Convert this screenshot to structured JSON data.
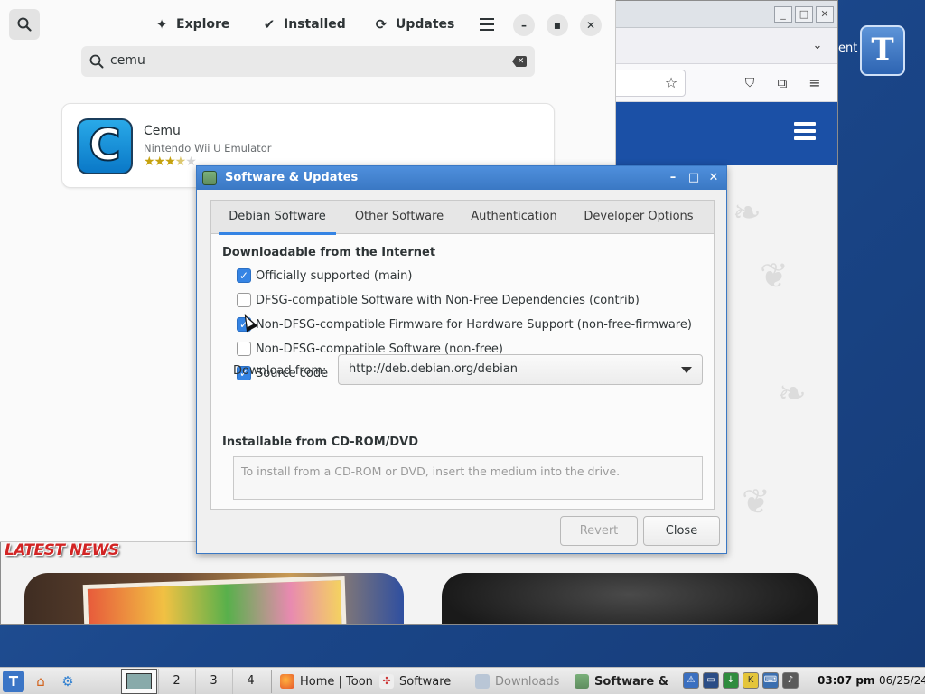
{
  "desktop": {
    "partial_text": "ent"
  },
  "store": {
    "nav": [
      {
        "label": "Explore",
        "icon": "sparkle-icon"
      },
      {
        "label": "Installed",
        "icon": "check-circle-icon"
      },
      {
        "label": "Updates",
        "icon": "refresh-icon"
      }
    ],
    "search_value": "cemu",
    "result": {
      "name": "Cemu",
      "summary": "Nintendo Wii U Emulator",
      "rating_stars": 3.5,
      "rating_max": 5
    }
  },
  "website": {
    "latest_news": "LATEST NEWS"
  },
  "dialog": {
    "title": "Software & Updates",
    "tabs": [
      "Debian Software",
      "Other Software",
      "Authentication",
      "Developer Options"
    ],
    "active_tab": 0,
    "downloadable_heading": "Downloadable from the Internet",
    "components": [
      {
        "label": "Officially supported (main)",
        "checked": true
      },
      {
        "label": "DFSG-compatible Software with Non-Free Dependencies (contrib)",
        "checked": false
      },
      {
        "label": "Non-DFSG-compatible Firmware for Hardware Support (non-free-firmware)",
        "checked": true
      },
      {
        "label": "Non-DFSG-compatible Software (non-free)",
        "checked": false
      },
      {
        "label": "Source code",
        "checked": true
      }
    ],
    "download_from_label": "Download from:",
    "download_from_value": "http://deb.debian.org/debian",
    "cdrom_heading": "Installable from CD-ROM/DVD",
    "cdrom_placeholder": "To install from a CD-ROM or DVD, insert the medium into the drive.",
    "buttons": {
      "revert": "Revert",
      "close": "Close"
    }
  },
  "taskbar": {
    "workspaces": [
      "1",
      "2",
      "3",
      "4"
    ],
    "current_workspace": 0,
    "tasks": [
      {
        "label": "Home | Toon",
        "state": "normal"
      },
      {
        "label": "Software",
        "state": "normal"
      },
      {
        "label": "Downloads",
        "state": "dim"
      },
      {
        "label": "Software &",
        "state": "active"
      }
    ],
    "clock": "03:07 pm",
    "date": "06/25/24"
  },
  "colors": {
    "accent": "#3584e4",
    "dialog_titlebar": "#3a78c4",
    "site_header": "#1b50a6",
    "desktop": "#1d4a8c"
  }
}
